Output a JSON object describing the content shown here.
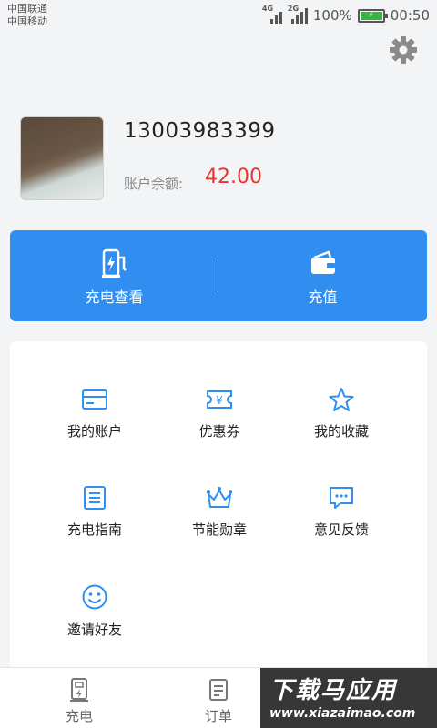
{
  "status_bar": {
    "carrier_1": "中国联通",
    "carrier_2": "中国移动",
    "sig1_tag": "4G",
    "sig2_tag": "2G",
    "battery": "100%",
    "time": "00:50"
  },
  "profile": {
    "phone": "13003983399",
    "balance_label": "账户余额:",
    "balance_value": "42.00"
  },
  "actions": {
    "charge_view": "充电查看",
    "recharge": "充值"
  },
  "grid": [
    {
      "label": "我的账户",
      "icon": "card-icon"
    },
    {
      "label": "优惠券",
      "icon": "coupon-icon"
    },
    {
      "label": "我的收藏",
      "icon": "star-icon"
    },
    {
      "label": "充电指南",
      "icon": "guide-icon"
    },
    {
      "label": "节能勋章",
      "icon": "crown-icon"
    },
    {
      "label": "意见反馈",
      "icon": "feedback-icon"
    },
    {
      "label": "邀请好友",
      "icon": "smile-icon"
    }
  ],
  "bottom_nav": {
    "charge": "充电",
    "orders": "订单"
  },
  "watermark": {
    "title": "下载马应用",
    "url": "www.xiazaimao.com"
  },
  "colors": {
    "accent": "#2f8ef0",
    "balance": "#e8352c",
    "icon_blue": "#2f8ef0"
  }
}
